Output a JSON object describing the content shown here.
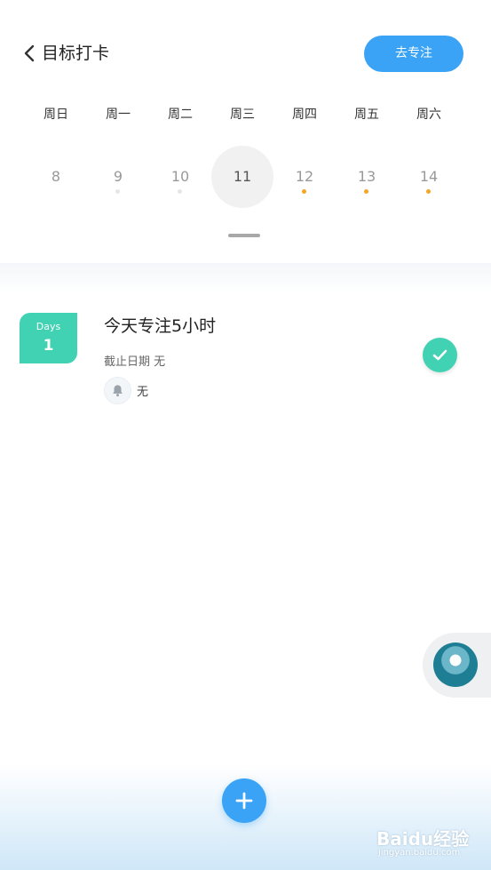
{
  "header": {
    "title": "目标打卡",
    "focus_button_label": "去专注"
  },
  "calendar": {
    "weekdays": [
      "周日",
      "周一",
      "周二",
      "周三",
      "周四",
      "周五",
      "周六"
    ],
    "dates": [
      {
        "day": "8",
        "marker": "none"
      },
      {
        "day": "9",
        "marker": "grey"
      },
      {
        "day": "10",
        "marker": "grey"
      },
      {
        "day": "11",
        "marker": "none",
        "selected": true
      },
      {
        "day": "12",
        "marker": "orange"
      },
      {
        "day": "13",
        "marker": "orange"
      },
      {
        "day": "14",
        "marker": "orange"
      }
    ]
  },
  "task": {
    "days_label": "Days",
    "days_count": "1",
    "title": "今天专注5小时",
    "deadline": "截止日期 无",
    "reminder": "无"
  },
  "colors": {
    "accent_blue": "#3aa3f5",
    "accent_green": "#41d2b3",
    "marker_orange": "#f5a623"
  },
  "watermark": {
    "logo": "Baidu经验",
    "url": "jingyan.baidu.com"
  }
}
